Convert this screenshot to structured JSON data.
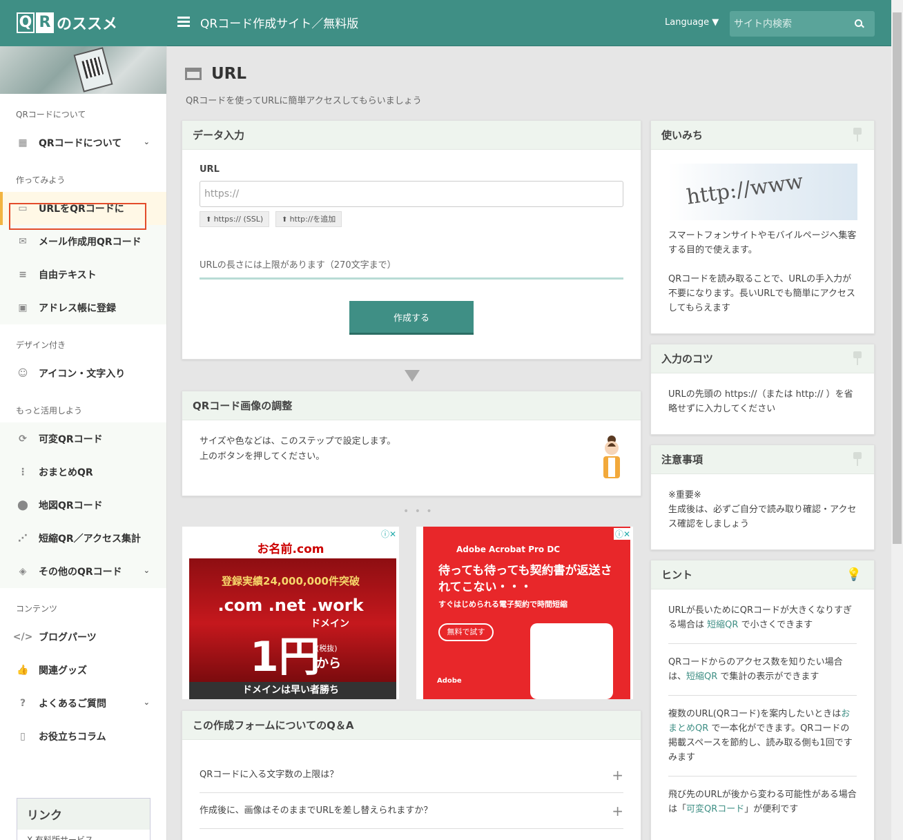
{
  "header": {
    "logo_q": "Q",
    "logo_r": "R",
    "logo_text": "のススメ",
    "site_title": "QRコード作成サイト／無料版",
    "language": "Language ▼",
    "search_placeholder": "サイト内検索"
  },
  "sidebar": {
    "group_about": "QRコードについて",
    "item_about": "QRコードについて",
    "group_make": "作ってみよう",
    "item_url": "URLをQRコードに",
    "item_mail": "メール作成用QRコード",
    "item_text": "自由テキスト",
    "item_address": "アドレス帳に登録",
    "group_design": "デザイン付き",
    "item_icon": "アイコン・文字入り",
    "group_more": "もっと活用しよう",
    "item_variable": "可変QRコード",
    "item_summary": "おまとめQR",
    "item_map": "地図QRコード",
    "item_short": "短縮QR／アクセス集計",
    "item_other": "その他のQRコード",
    "group_contents": "コンテンツ",
    "item_blog": "ブログパーツ",
    "item_goods": "関連グッズ",
    "item_faq": "よくあるご質問",
    "item_column": "お役立ちコラム",
    "links_title": "リンク",
    "links_item": "X 有料版サービス"
  },
  "main": {
    "title": "URL",
    "subtitle": "QRコードを使ってURLに簡単アクセスしてもらいましょう",
    "data_input": {
      "header": "データ入力",
      "url_label": "URL",
      "url_placeholder": "https://",
      "btn_ssl": "https:// (SSL)",
      "btn_http": "http://を追加",
      "limit_note": "URLの長さには上限があります（270文字まで）",
      "create_button": "作成する"
    },
    "adjust": {
      "header": "QRコード画像の調整",
      "line1": "サイズや色などは、このステップで設定します。",
      "line2": "上のボタンを押してください。"
    },
    "ads": {
      "ad1_top": "お名前.com",
      "ad1_count": "登録実績24,000,000件突破",
      "ad1_domains": ".com .net .work",
      "ad1_domain_word": "ドメイン",
      "ad1_price": "1円",
      "ad1_tax": "(税抜)",
      "ad1_from": "から",
      "ad1_bottom": "ドメインは早い者勝ち",
      "ad2_brand": "Adobe Acrobat Pro DC",
      "ad2_head": "待っても待っても契約書が返送されてこない・・・",
      "ad2_sub": "すぐはじめられる電子契約で時間短縮",
      "ad2_btn": "無料で試す",
      "ad2_logo": "Adobe"
    },
    "qa": {
      "header": "この作成フォームについてのQ＆A",
      "q1": "QRコードに入る文字数の上限は？",
      "q2": "作成後に、画像はそのままでURLを差し替えられますか？"
    }
  },
  "right": {
    "usage": {
      "header": "使いみち",
      "img_text": "http://www",
      "p1": "スマートフォンサイトやモバイルページへ集客する目的で使えます。",
      "p2": "QRコードを読み取ることで、URLの手入力が不要になります。長いURLでも簡単にアクセスしてもらえます"
    },
    "tips": {
      "header": "入力のコツ",
      "p1": "URLの先頭の https://（または http:// ）を省略せずに入力してください"
    },
    "notes": {
      "header": "注意事項",
      "p1": "※重要※",
      "p2": "生成後は、必ずご自分で読み取り確認・アクセス確認をしましょう"
    },
    "hint": {
      "header": "ヒント",
      "h1a": "URLが長いためにQRコードが大きくなりすぎる場合は",
      "h1link": "短縮QR",
      "h1b": "で小さくできます",
      "h2a": "QRコードからのアクセス数を知りたい場合は、",
      "h2link": "短縮QR",
      "h2b": "で集計の表示ができます",
      "h3a": "複数のURL(QRコード)を案内したいときは",
      "h3link": "おまとめQR",
      "h3b": "で一本化ができます。QRコードの掲載スペースを節約し、読み取る側も1回ですみます",
      "h4a": "飛び先のURLが後から変わる可能性がある場合は「",
      "h4link": "可変QRコード",
      "h4b": "」が便利です"
    }
  },
  "colors": {
    "accent": "#3f8f85",
    "highlight": "#e34b2a"
  }
}
